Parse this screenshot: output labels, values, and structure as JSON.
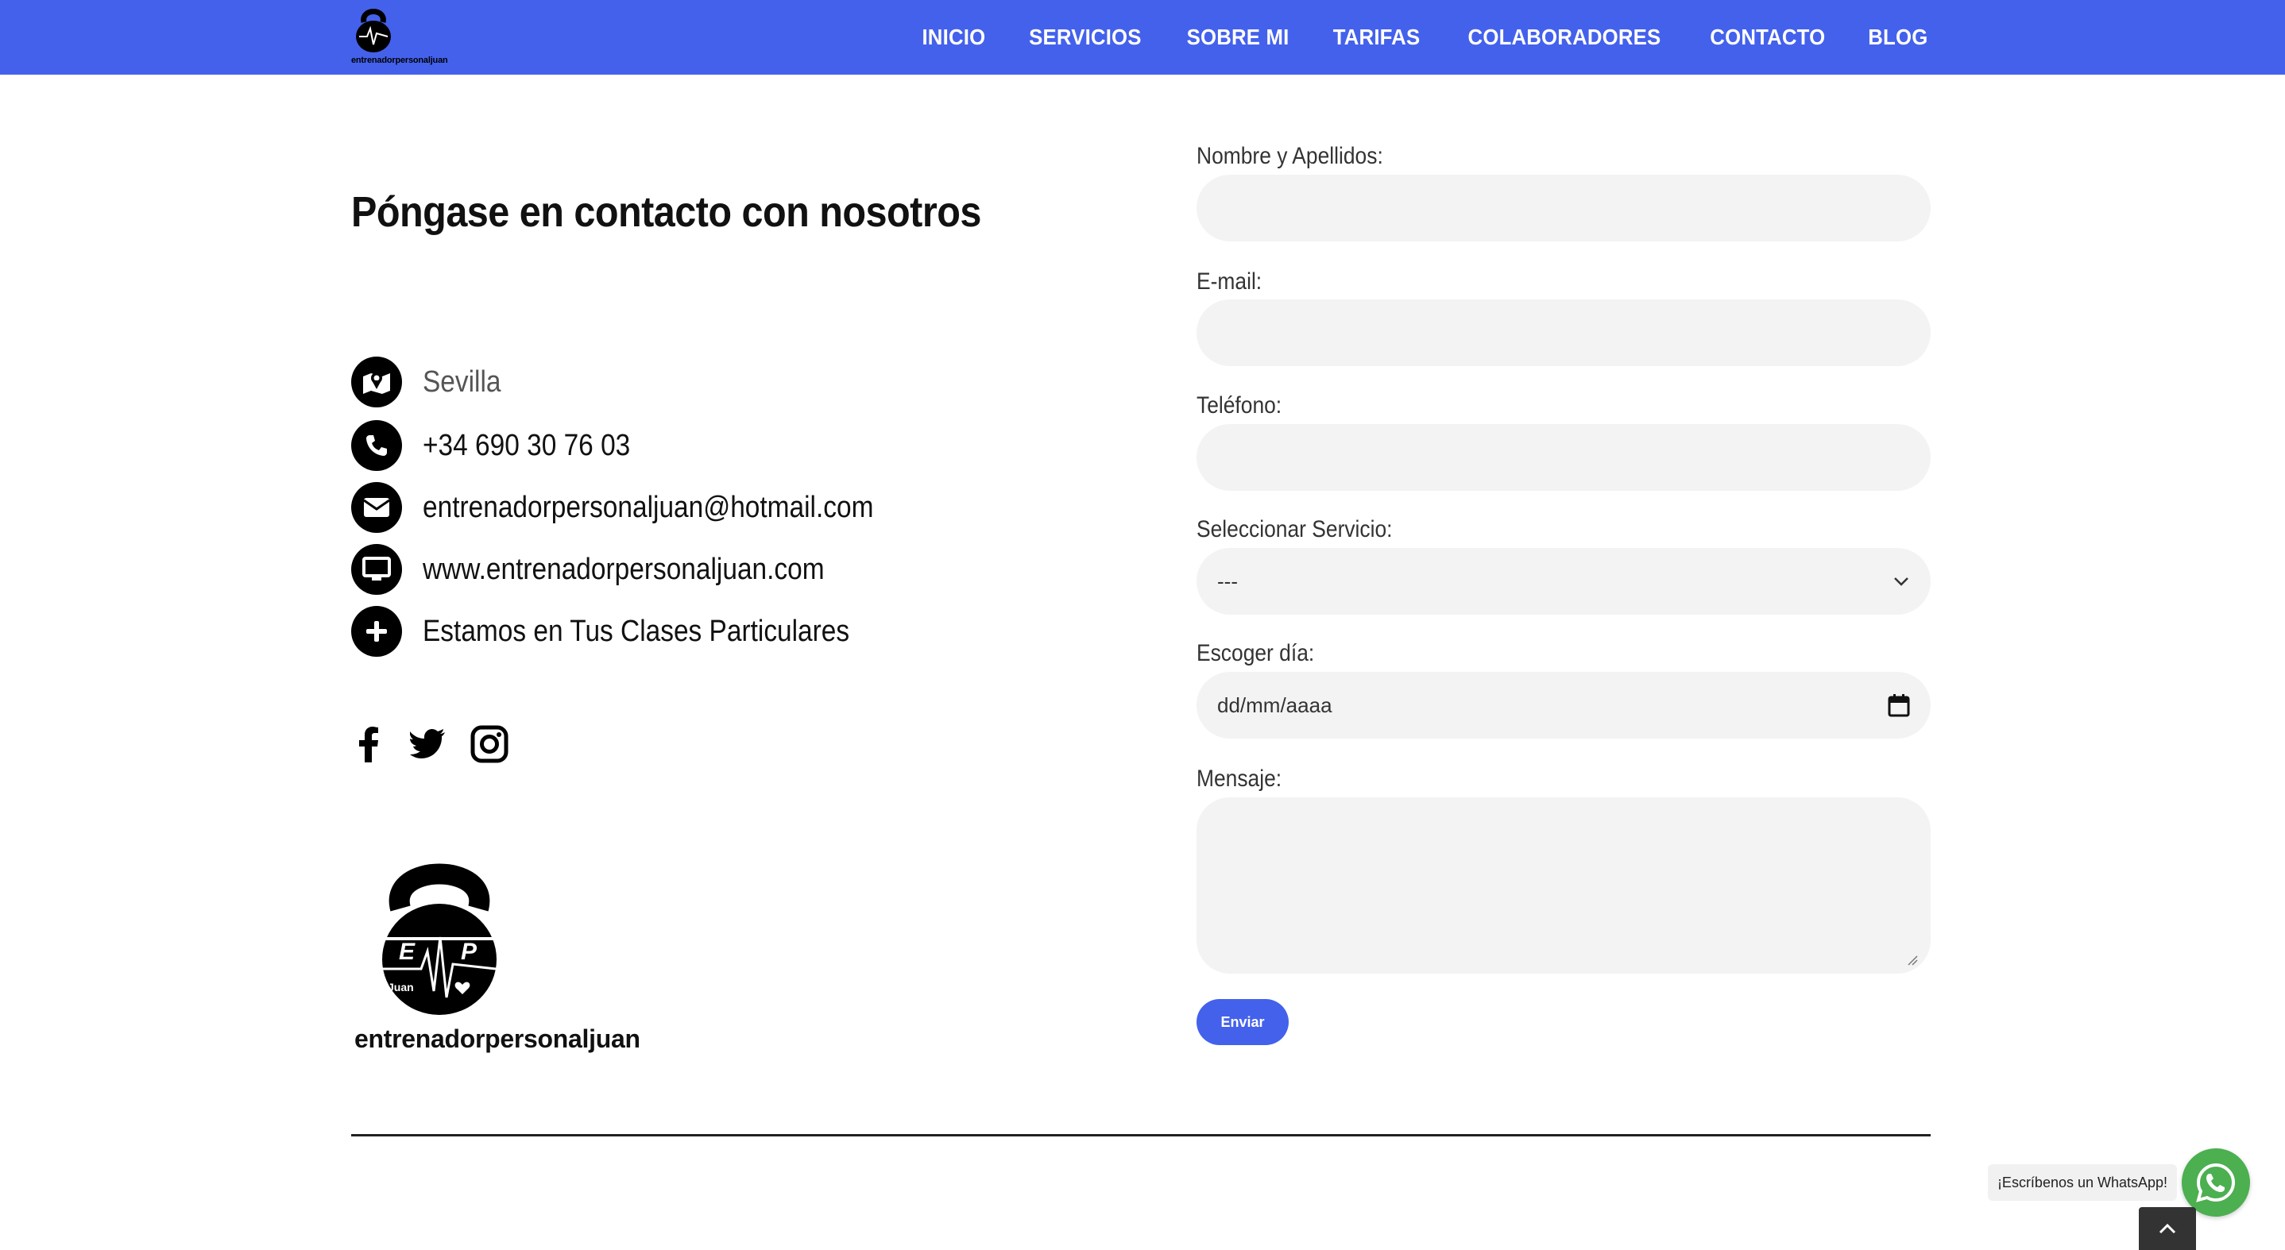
{
  "header": {
    "brand_text": "entrenadorpersonaljuan",
    "nav": [
      "INICIO",
      "SERVICIOS",
      "SOBRE MI",
      "TARIFAS",
      "COLABORADORES",
      "CONTACTO",
      "BLOG"
    ],
    "accent_color": "#4461ec"
  },
  "contact": {
    "heading": "Póngase en contacto con nosotros",
    "items": [
      {
        "icon": "map-icon",
        "text": "Sevilla"
      },
      {
        "icon": "phone-icon",
        "text": "+34 690 30 76 03"
      },
      {
        "icon": "envelope-icon",
        "text": "entrenadorpersonaljuan@hotmail.com"
      },
      {
        "icon": "monitor-icon",
        "text": "www.entrenadorpersonaljuan.com"
      },
      {
        "icon": "plus-icon",
        "text": "Estamos en Tus Clases Particulares"
      }
    ],
    "socials": [
      "facebook-icon",
      "twitter-icon",
      "instagram-icon"
    ],
    "logo_text": "entrenadorpersonaljuan",
    "logo_letters": {
      "left": "E",
      "right": "P",
      "small": "Juan"
    }
  },
  "form": {
    "name_label": "Nombre y Apellidos:",
    "email_label": "E-mail:",
    "phone_label": "Teléfono:",
    "service_label": "Seleccionar Servicio:",
    "service_value": "---",
    "date_label": "Escoger día:",
    "date_placeholder": "dd/mm/aaaa",
    "message_label": "Mensaje:",
    "submit_label": "Enviar"
  },
  "whatsapp": {
    "tooltip": "¡Escríbenos un WhatsApp!",
    "color": "#4caf50"
  }
}
